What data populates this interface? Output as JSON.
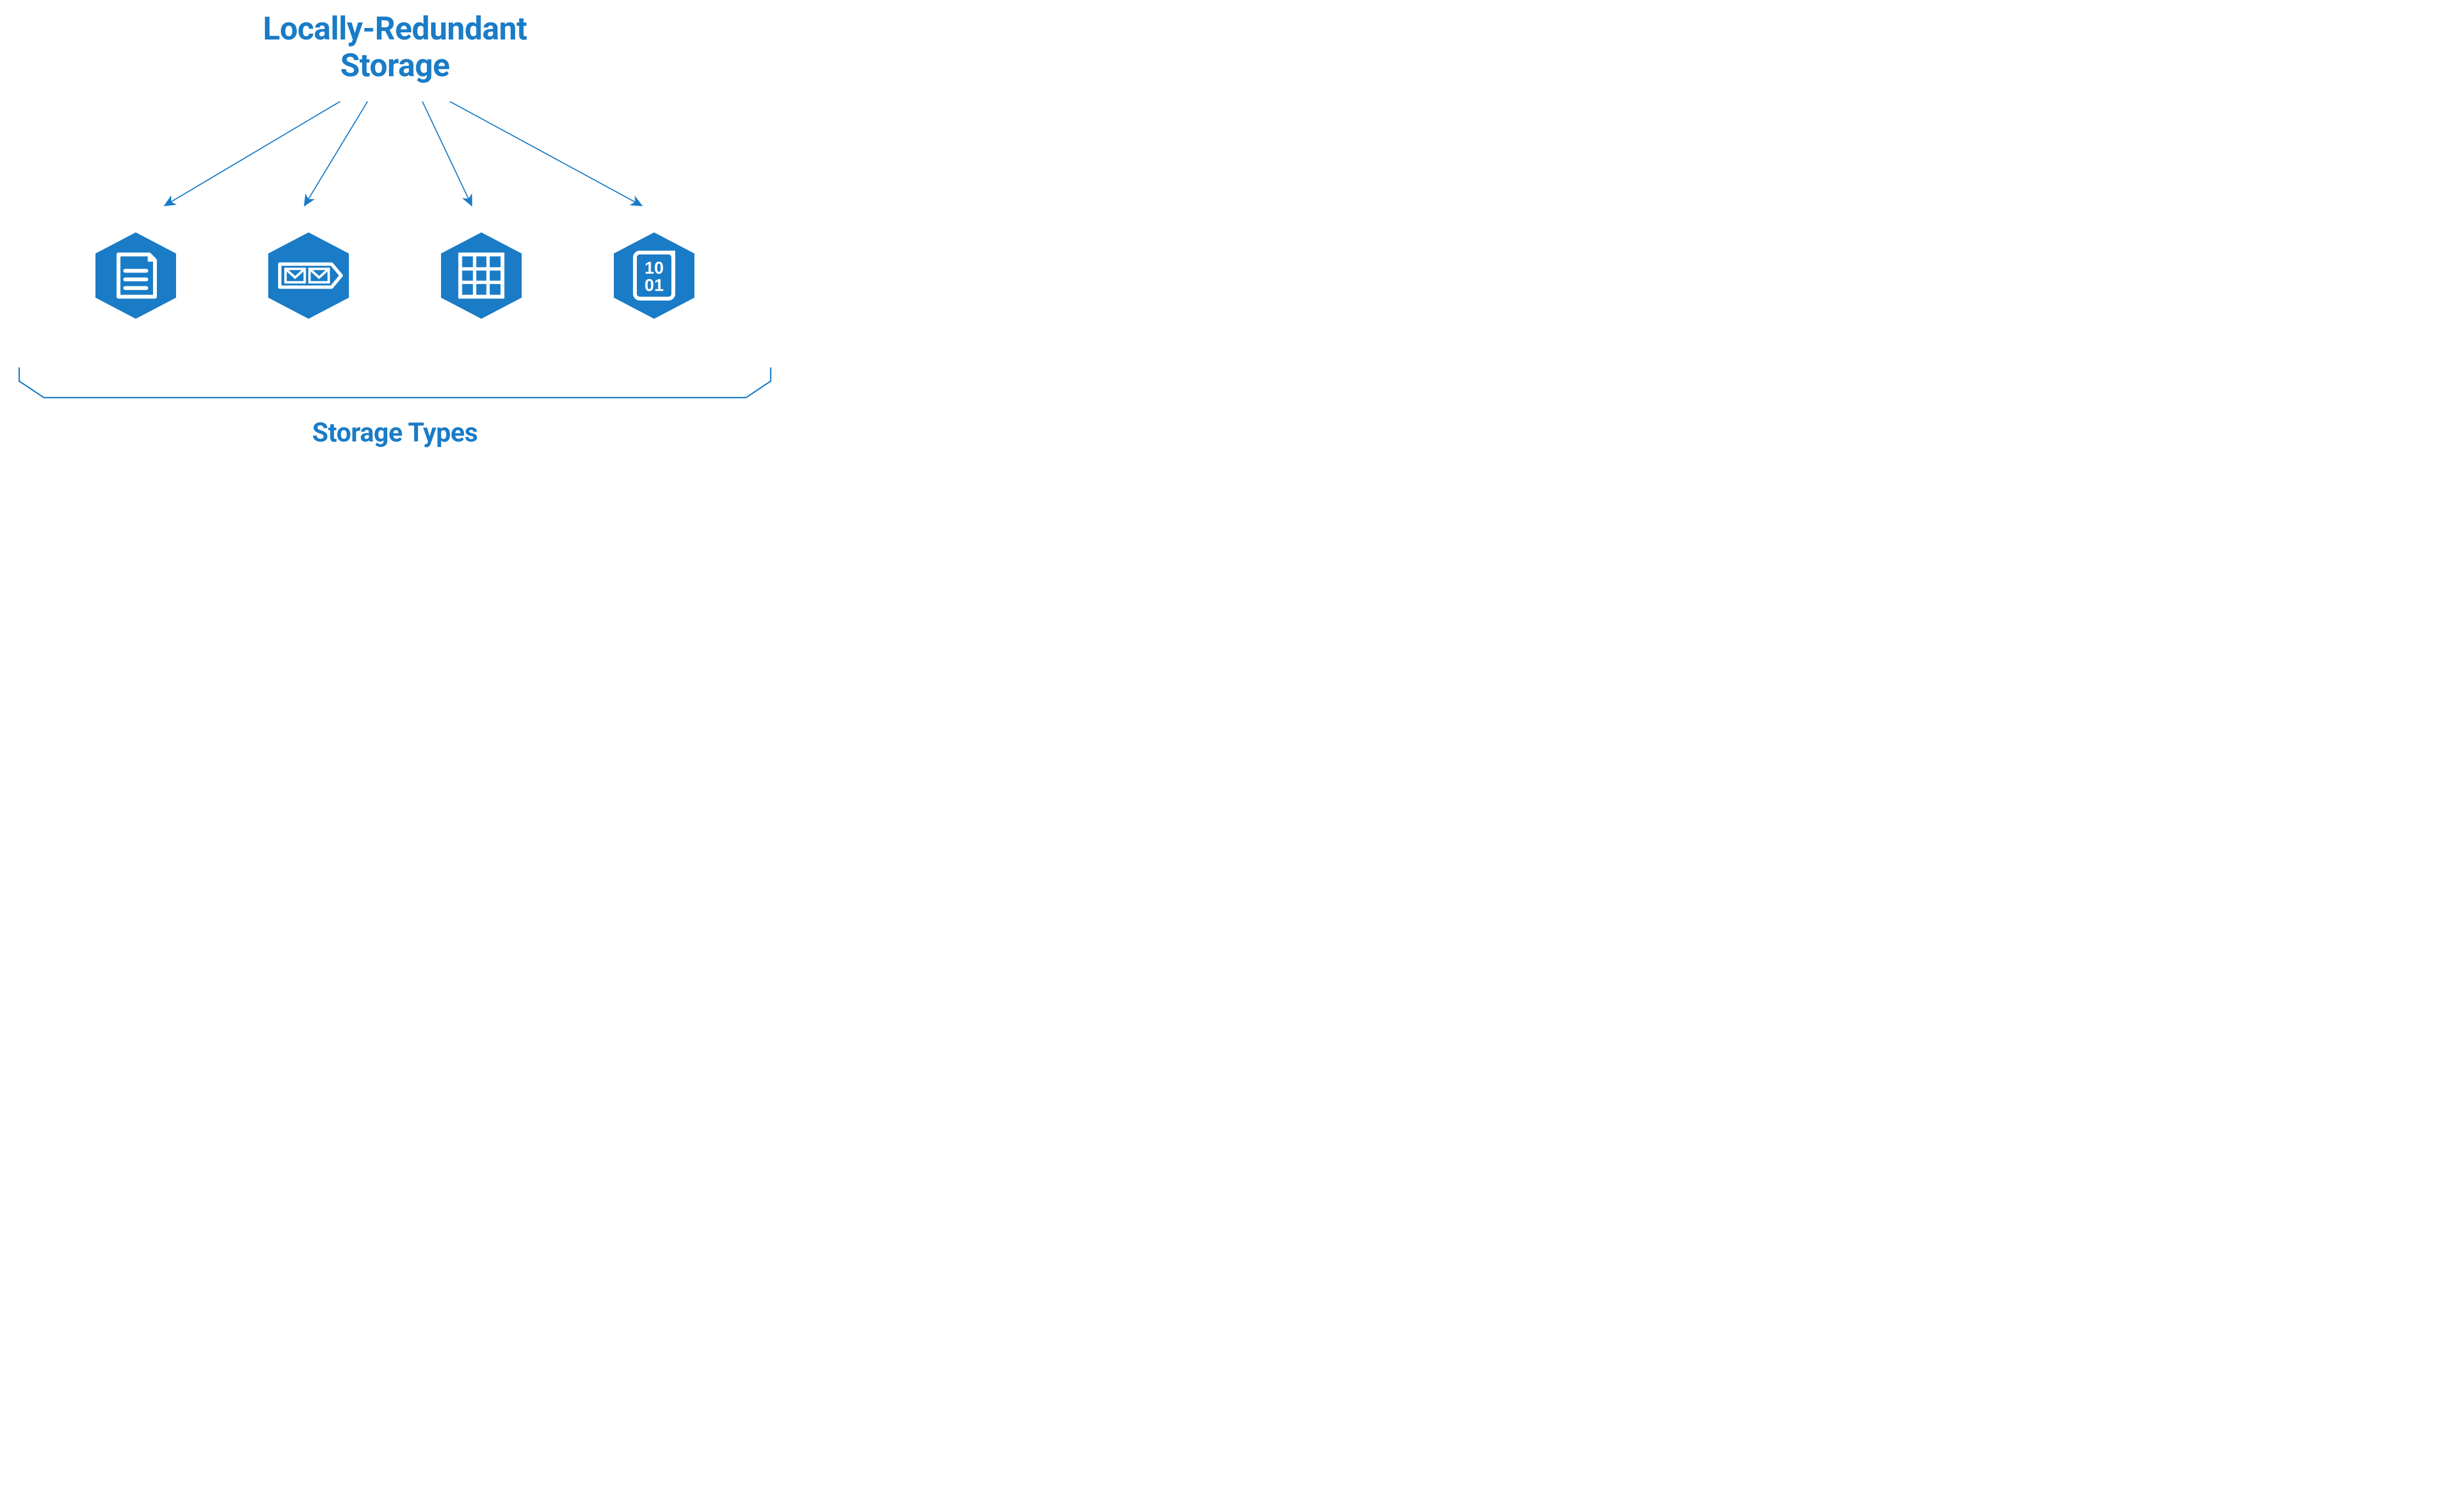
{
  "title_line1": "Locally-Redundant",
  "title_line2": "Storage",
  "storage_types": [
    {
      "name": "file-storage",
      "icon": "file-icon"
    },
    {
      "name": "queue-storage",
      "icon": "queue-icon"
    },
    {
      "name": "table-storage",
      "icon": "table-icon"
    },
    {
      "name": "blob-storage",
      "icon": "blob-icon"
    }
  ],
  "bottom_label": "Storage Types",
  "colors": {
    "brand_blue": "#1a7cc7",
    "background": "#ffffff"
  }
}
